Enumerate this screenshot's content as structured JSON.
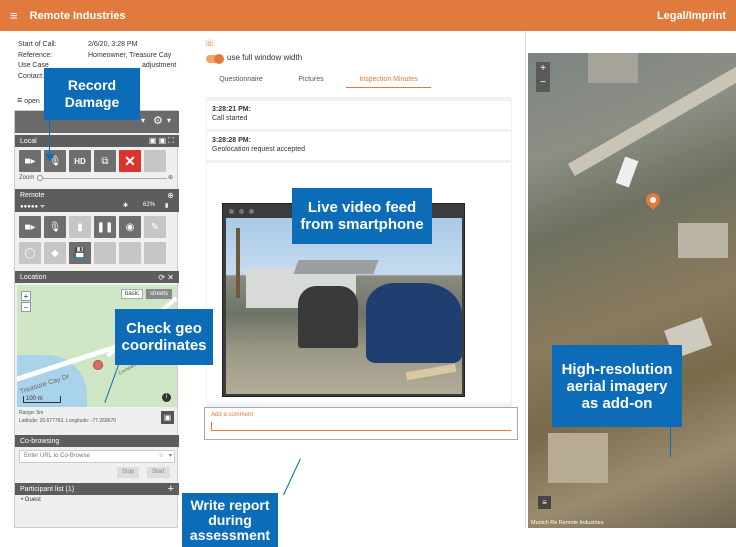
{
  "app": {
    "title": "Remote Industries",
    "menu_icon": "menu-icon",
    "legal": "Legal/Imprint"
  },
  "call_info": [
    {
      "label": "Start of Call:",
      "value": "2/6/20, 3:28 PM"
    },
    {
      "label": "Reference:",
      "value": "Homeowner, Treasure Cay"
    },
    {
      "label": "Use Case",
      "value": "adjustment"
    },
    {
      "label": "Contact:",
      "value": ""
    }
  ],
  "open_label": "open",
  "local": {
    "title": "Local",
    "zoom_label": "Zoom",
    "hd_label": "HD",
    "header_icons": "▣ ▣ ⛶"
  },
  "remote": {
    "title": "Remote",
    "signal": "●●●●● ᯤ",
    "battery": "62%"
  },
  "location": {
    "title": "Location",
    "map_modes": [
      "basic",
      "streets"
    ],
    "zoom_in": "+",
    "zoom_out": "−",
    "scale": "100 m",
    "street_1": "Treasure Cay Dr",
    "street_2": "Compass Way",
    "range": "Range: 5m",
    "coords": "Latitude: 26.677763, Longitude: -77.269670"
  },
  "cobrowsing": {
    "title": "Co-browsing",
    "placeholder": "Enter URL to Co-Browse",
    "stop_label": "Stop",
    "start_label": "Start"
  },
  "participants": {
    "title": "Participant list (1)",
    "items": [
      "Guest"
    ]
  },
  "middle": {
    "toggle_label": "use full window width",
    "tabs": [
      {
        "label": "Questionnaire",
        "active": false
      },
      {
        "label": "Pictures",
        "active": false
      },
      {
        "label": "Inspection Minutes",
        "active": true
      }
    ],
    "entries": [
      {
        "time": "3:28:21 PM:",
        "text": "Call started"
      },
      {
        "time": "3:28:28 PM:",
        "text": "Geolocation request accepted"
      }
    ],
    "comment_placeholder": "Add a comment"
  },
  "right_map": {
    "credit": "Munich Re Remote Industries",
    "zoom_in": "+",
    "zoom_out": "−"
  },
  "callouts": {
    "record": "Record Damage",
    "video": "Live video feed from smartphone",
    "geo": "Check geo coordinates",
    "aerial": "High-resolution aerial imagery as add-on",
    "report": "Write report during assessment"
  },
  "colors": {
    "accent": "#e07a3d",
    "callout": "#0c6cb7",
    "stop": "#d9352b"
  }
}
